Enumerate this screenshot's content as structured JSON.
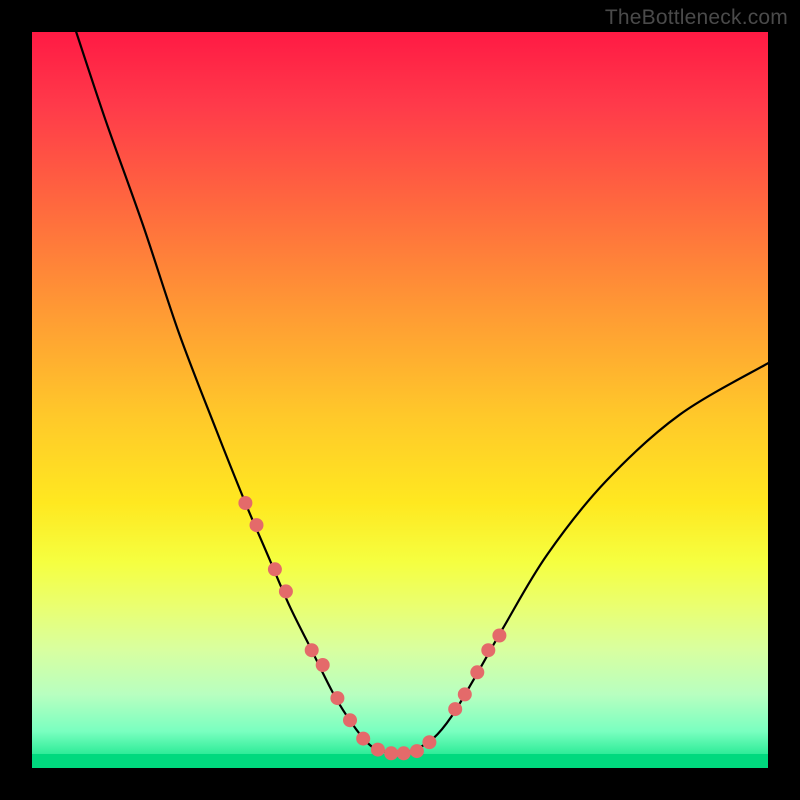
{
  "watermark": "TheBottleneck.com",
  "colors": {
    "background": "#000000",
    "curve": "#000000",
    "dots": "#e46a6a",
    "gradient_top": "#ff1a44",
    "gradient_bottom": "#00d97e"
  },
  "chart_data": {
    "type": "line",
    "title": "",
    "xlabel": "",
    "ylabel": "",
    "xlim": [
      0,
      100
    ],
    "ylim": [
      0,
      100
    ],
    "grid": false,
    "legend": false,
    "note": "No axis ticks or labels are rendered in the image; values below are estimated from pixel position on a 0–100 normalized square (y = 0 at bottom).",
    "series": [
      {
        "name": "curve",
        "x": [
          6,
          10,
          15,
          20,
          25,
          29,
          32,
          35,
          38,
          41,
          43.5,
          45.5,
          47,
          49.5,
          52,
          54.5,
          57,
          60,
          64,
          70,
          78,
          88,
          100
        ],
        "y": [
          100,
          88,
          74,
          59,
          46,
          36,
          29,
          22,
          16,
          10,
          6,
          3.5,
          2.5,
          2,
          2.5,
          4,
          7,
          12,
          19,
          29,
          39,
          48,
          55
        ]
      }
    ],
    "markers": {
      "name": "dots",
      "comment": "pink dots overlaid on the curve",
      "x": [
        29,
        30.5,
        33,
        34.5,
        38,
        39.5,
        41.5,
        43.2,
        45,
        47,
        48.8,
        50.5,
        52.3,
        54,
        57.5,
        58.8,
        60.5,
        62,
        63.5
      ],
      "y": [
        36,
        33,
        27,
        24,
        16,
        14,
        9.5,
        6.5,
        4,
        2.5,
        2,
        2,
        2.3,
        3.5,
        8,
        10,
        13,
        16,
        18
      ]
    }
  }
}
